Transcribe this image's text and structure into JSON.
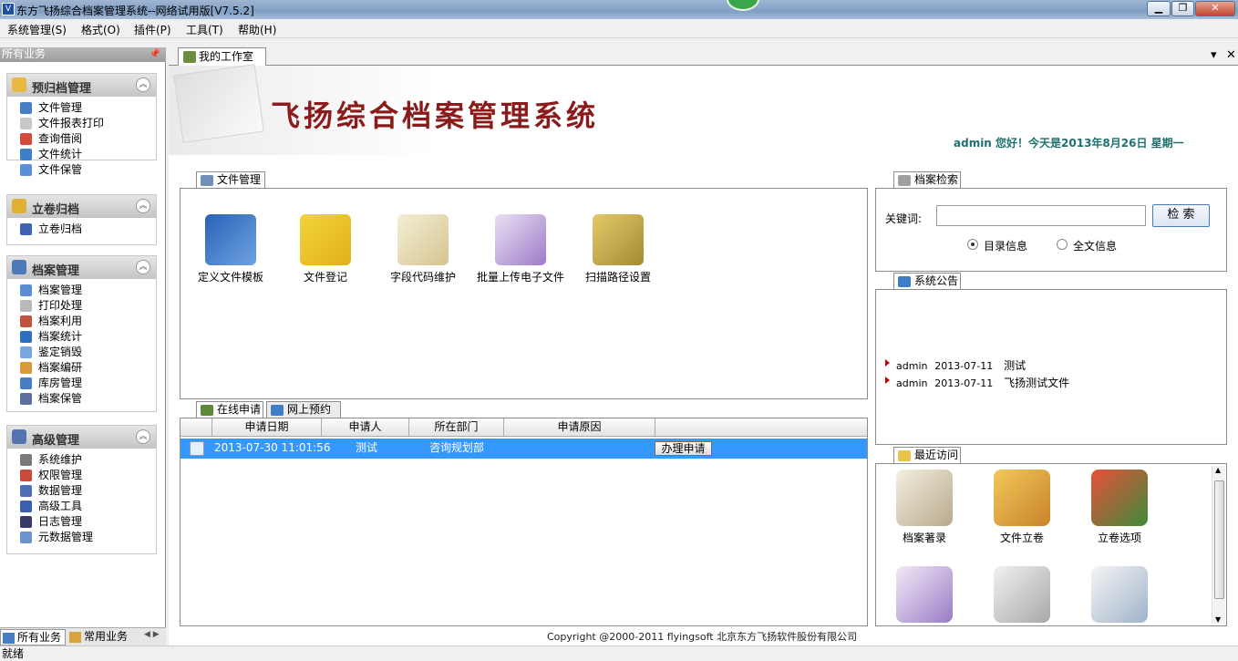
{
  "window": {
    "title": "东方飞扬综合档案管理系统--网络试用版[V7.5.2]",
    "minimize_icon": "minimize-icon",
    "maximize_icon": "maximize-icon",
    "close_icon": "close-icon"
  },
  "menu": [
    "系统管理(S)",
    "格式(O)",
    "插件(P)",
    "工具(T)",
    "帮助(H)"
  ],
  "sidebar": {
    "header": "所有业务",
    "groups": [
      {
        "label": "预归档管理",
        "items": [
          "文件管理",
          "文件报表打印",
          "查询借阅",
          "文件统计",
          "文件保管"
        ]
      },
      {
        "label": "立卷归档",
        "items": [
          "立卷归档"
        ]
      },
      {
        "label": "档案管理",
        "items": [
          "档案管理",
          "打印处理",
          "档案利用",
          "档案统计",
          "鉴定销毁",
          "档案编研",
          "库房管理",
          "档案保管"
        ]
      },
      {
        "label": "高级管理",
        "items": [
          "系统维护",
          "权限管理",
          "数据管理",
          "高级工具",
          "日志管理",
          "元数据管理"
        ]
      }
    ],
    "bottom_tabs": [
      "所有业务",
      "常用业务"
    ]
  },
  "main": {
    "tab_label": "我的工作室",
    "banner_title": "飞扬综合档案管理系统",
    "greeting": "admin 您好！今天是2013年8月26日 星期一",
    "file_mgmt": {
      "tab": "文件管理",
      "items": [
        "定义文件模板",
        "文件登记",
        "字段代码维护",
        "批量上传电子文件",
        "扫描路径设置"
      ]
    },
    "apply": {
      "tabs": [
        "在线申请",
        "网上预约"
      ],
      "columns": [
        "申请日期",
        "申请人",
        "所在部门",
        "申请原因"
      ],
      "rows": [
        {
          "date": "2013-07-30 11:01:56",
          "applicant": "测试",
          "department": "咨询规划部",
          "reason": "",
          "action": "办理申请"
        }
      ]
    },
    "search": {
      "tab": "档案检索",
      "keyword_label": "关键词:",
      "keyword_value": "",
      "button": "检 索",
      "options": [
        "目录信息",
        "全文信息"
      ],
      "selected": "目录信息"
    },
    "notice": {
      "tab": "系统公告",
      "items": [
        {
          "user": "admin",
          "date": "2013-07-11",
          "text": "测试"
        },
        {
          "user": "admin",
          "date": "2013-07-11",
          "text": "飞扬测试文件"
        }
      ]
    },
    "recent": {
      "tab": "最近访问",
      "items": [
        "档案著录",
        "文件立卷",
        "立卷选项"
      ]
    },
    "copyright": "Copyright @2000-2011 flyingsoft 北京东方飞扬软件股份有限公司"
  },
  "status": "就绪"
}
